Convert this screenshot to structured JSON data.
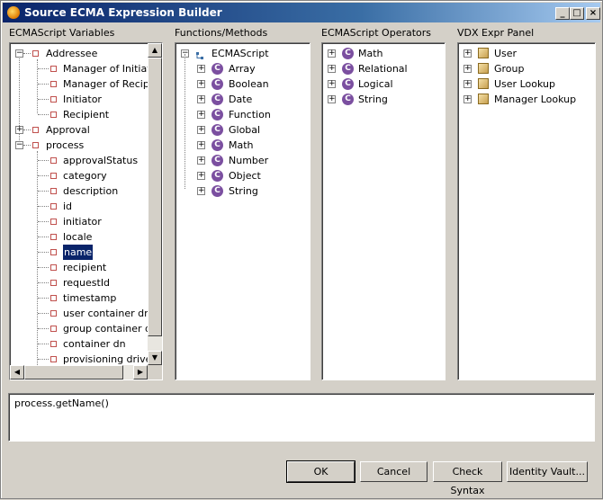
{
  "window": {
    "title": "Source ECMA Expression Builder"
  },
  "titlebar": {
    "min": "_",
    "max": "□",
    "close": "×"
  },
  "panels": {
    "variables": {
      "label": "ECMAScript Variables",
      "items": [
        {
          "label": "Addressee",
          "level": 0,
          "expander": "−"
        },
        {
          "label": "Manager of Initiator",
          "level": 1
        },
        {
          "label": "Manager of Recipient",
          "level": 1
        },
        {
          "label": "Initiator",
          "level": 1
        },
        {
          "label": "Recipient",
          "level": 1
        },
        {
          "label": "Approval",
          "level": 0,
          "expander": "+"
        },
        {
          "label": "process",
          "level": 0,
          "expander": "−"
        },
        {
          "label": "approvalStatus",
          "level": 1
        },
        {
          "label": "category",
          "level": 1
        },
        {
          "label": "description",
          "level": 1
        },
        {
          "label": "id",
          "level": 1
        },
        {
          "label": "initiator",
          "level": 1
        },
        {
          "label": "locale",
          "level": 1
        },
        {
          "label": "name",
          "level": 1,
          "selected": true
        },
        {
          "label": "recipient",
          "level": 1
        },
        {
          "label": "requestId",
          "level": 1
        },
        {
          "label": "timestamp",
          "level": 1
        },
        {
          "label": "user container dn",
          "level": 1
        },
        {
          "label": "group container dn",
          "level": 1
        },
        {
          "label": "container dn",
          "level": 1
        },
        {
          "label": "provisioning driver dn",
          "level": 1
        }
      ]
    },
    "functions": {
      "label": "Functions/Methods",
      "root": {
        "label": "ECMAScript",
        "expander": "−"
      },
      "items": [
        {
          "label": "Array",
          "icon": "C"
        },
        {
          "label": "Boolean",
          "icon": "C"
        },
        {
          "label": "Date",
          "icon": "C"
        },
        {
          "label": "Function",
          "icon": "C"
        },
        {
          "label": "Global",
          "icon": "C"
        },
        {
          "label": "Math",
          "icon": "C"
        },
        {
          "label": "Number",
          "icon": "C"
        },
        {
          "label": "Object",
          "icon": "C"
        },
        {
          "label": "String",
          "icon": "C"
        }
      ]
    },
    "operators": {
      "label": "ECMAScript Operators",
      "items": [
        {
          "label": "Math",
          "icon": "C"
        },
        {
          "label": "Relational",
          "icon": "C"
        },
        {
          "label": "Logical",
          "icon": "C"
        },
        {
          "label": "String",
          "icon": "C"
        }
      ]
    },
    "vdx": {
      "label": "VDX Expr Panel",
      "items": [
        {
          "label": "User"
        },
        {
          "label": "Group"
        },
        {
          "label": "User Lookup"
        },
        {
          "label": "Manager Lookup"
        }
      ]
    }
  },
  "expression": {
    "value": "process.getName()"
  },
  "buttons": {
    "ok": "OK",
    "cancel": "Cancel",
    "check_syntax": "Check Syntax",
    "identity_vault": "Identity Vault..."
  },
  "scroll": {
    "up": "▲",
    "down": "▼",
    "left": "◀",
    "right": "▶"
  }
}
